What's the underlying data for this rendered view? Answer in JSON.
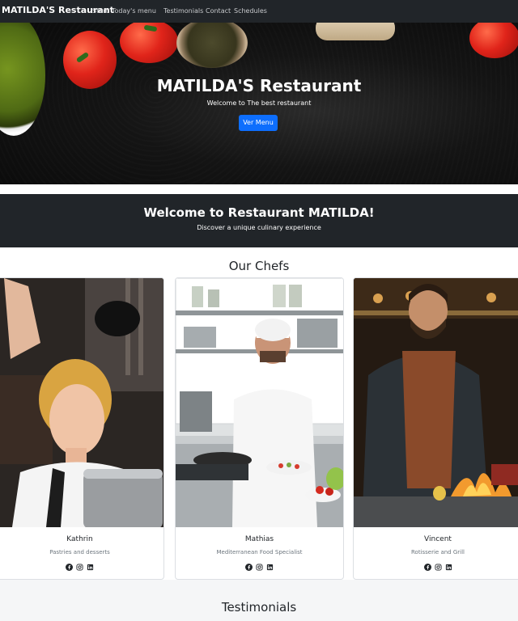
{
  "nav": {
    "brand": "MATILDA'S Restaurant",
    "links": [
      "Start",
      "Today's menu",
      "Testimonials",
      "Contact",
      "Schedules"
    ]
  },
  "hero": {
    "title": "MATILDA'S Restaurant",
    "subtitle": "Welcome to The best restaurant",
    "button": "Ver Menu"
  },
  "welcome": {
    "title": "Welcome to Restaurant MATILDA!",
    "subtitle": "Discover a unique culinary experience"
  },
  "chefs": {
    "title": "Our Chefs",
    "items": [
      {
        "name": "Kathrin",
        "role": "Pastries and desserts"
      },
      {
        "name": "Mathias",
        "role": "Mediterranean Food Specialist"
      },
      {
        "name": "Vincent",
        "role": "Rotisserie and Grill"
      }
    ],
    "social_icons": [
      "facebook-icon",
      "instagram-icon",
      "linkedin-icon"
    ]
  },
  "testimonials": {
    "title": "Testimonials"
  },
  "colors": {
    "navbar": "#212529",
    "primary_button": "#0d6efd",
    "banner": "#212529",
    "section_bg": "#f5f6f7"
  }
}
